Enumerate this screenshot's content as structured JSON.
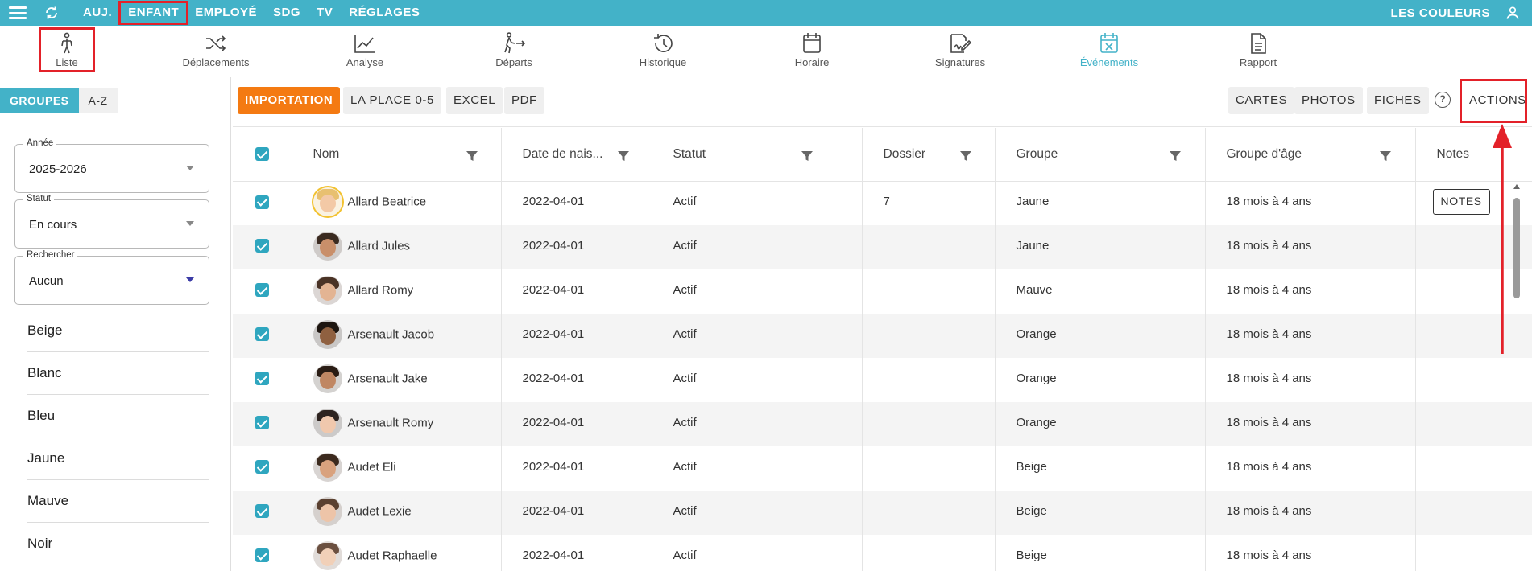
{
  "topbar": {
    "nav": [
      "AUJ.",
      "ENFANT",
      "EMPLOYÉ",
      "SDG",
      "TV",
      "RÉGLAGES"
    ],
    "right_label": "LES COULEURS"
  },
  "iconnav": [
    {
      "label": "Liste",
      "icon": "person-icon"
    },
    {
      "label": "Déplacements",
      "icon": "shuffle-icon"
    },
    {
      "label": "Analyse",
      "icon": "chart-line-icon"
    },
    {
      "label": "Départs",
      "icon": "walking-person-icon"
    },
    {
      "label": "Historique",
      "icon": "history-icon"
    },
    {
      "label": "Horaire",
      "icon": "calendar-icon"
    },
    {
      "label": "Signatures",
      "icon": "signature-icon"
    },
    {
      "label": "Événements",
      "icon": "calendar-x-icon"
    },
    {
      "label": "Rapport",
      "icon": "document-icon"
    }
  ],
  "sidebar": {
    "view_toggle": [
      "GROUPES",
      "A-Z"
    ],
    "fields": [
      {
        "label": "Année",
        "value": "2025-2026"
      },
      {
        "label": "Statut",
        "value": "En cours"
      },
      {
        "label": "Rechercher",
        "value": "Aucun"
      }
    ],
    "groups": [
      "Beige",
      "Blanc",
      "Bleu",
      "Jaune",
      "Mauve",
      "Noir"
    ]
  },
  "toolbar": {
    "left": [
      "IMPORTATION",
      "LA PLACE 0-5",
      "EXCEL",
      "PDF"
    ],
    "right": [
      "CARTES",
      "PHOTOS",
      "FICHES"
    ],
    "help": "?",
    "actions": "ACTIONS"
  },
  "table": {
    "headers": [
      "Nom",
      "Date de nais...",
      "Statut",
      "Dossier",
      "Groupe",
      "Groupe d'âge",
      "Notes"
    ],
    "notes_button": "NOTES",
    "rows": [
      {
        "name": "Allard Beatrice",
        "dob": "2022-04-01",
        "status": "Actif",
        "dossier": "7",
        "group": "Jaune",
        "age_group": "18 mois à 4 ans"
      },
      {
        "name": "Allard Jules",
        "dob": "2022-04-01",
        "status": "Actif",
        "dossier": "",
        "group": "Jaune",
        "age_group": "18 mois à 4 ans"
      },
      {
        "name": "Allard Romy",
        "dob": "2022-04-01",
        "status": "Actif",
        "dossier": "",
        "group": "Mauve",
        "age_group": "18 mois à 4 ans"
      },
      {
        "name": "Arsenault Jacob",
        "dob": "2022-04-01",
        "status": "Actif",
        "dossier": "",
        "group": "Orange",
        "age_group": "18 mois à 4 ans"
      },
      {
        "name": "Arsenault Jake",
        "dob": "2022-04-01",
        "status": "Actif",
        "dossier": "",
        "group": "Orange",
        "age_group": "18 mois à 4 ans"
      },
      {
        "name": "Arsenault Romy",
        "dob": "2022-04-01",
        "status": "Actif",
        "dossier": "",
        "group": "Orange",
        "age_group": "18 mois à 4 ans"
      },
      {
        "name": "Audet Eli",
        "dob": "2022-04-01",
        "status": "Actif",
        "dossier": "",
        "group": "Beige",
        "age_group": "18 mois à 4 ans"
      },
      {
        "name": "Audet Lexie",
        "dob": "2022-04-01",
        "status": "Actif",
        "dossier": "",
        "group": "Beige",
        "age_group": "18 mois à 4 ans"
      },
      {
        "name": "Audet Raphaelle",
        "dob": "2022-04-01",
        "status": "Actif",
        "dossier": "",
        "group": "Beige",
        "age_group": "18 mois à 4 ans"
      }
    ]
  },
  "colors": {
    "accent": "#43b2c8",
    "orange": "#f47a12",
    "highlight": "#e32129"
  }
}
